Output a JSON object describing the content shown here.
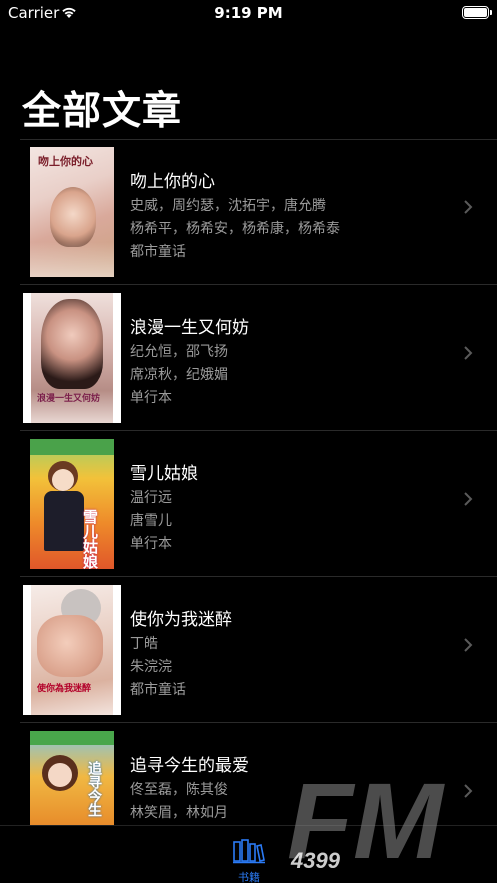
{
  "status": {
    "carrier": "Carrier",
    "time": "9:19 PM"
  },
  "page": {
    "title": "全部文章"
  },
  "books": [
    {
      "title": "吻上你的心",
      "lines": [
        "史威，周约瑟，沈拓宇，唐允腾",
        "杨希平，杨希安，杨希康，杨希泰",
        "都市童话"
      ],
      "cover_text": "吻上你的心"
    },
    {
      "title": "浪漫一生又何妨",
      "lines": [
        "纪允恒，邵飞扬",
        "席凉秋，纪娥媚",
        "单行本"
      ],
      "cover_text": "浪漫一生又何妨"
    },
    {
      "title": "雪儿姑娘",
      "lines": [
        "温行远",
        "唐雪儿",
        "单行本"
      ],
      "cover_text": "雪儿姑娘"
    },
    {
      "title": "使你为我迷醉",
      "lines": [
        "丁皓",
        "朱浣浣",
        "都市童话"
      ],
      "cover_text": "使你為我迷醉"
    },
    {
      "title": "追寻今生的最爱",
      "lines": [
        "佟至磊，陈其俊",
        "林笑眉，林如月"
      ],
      "cover_text": "追寻今生"
    }
  ],
  "tabbar": {
    "tab_label": "书籍",
    "accent": "#2b7bf6"
  },
  "watermark": {
    "text": "FM",
    "subtext": "4399"
  }
}
